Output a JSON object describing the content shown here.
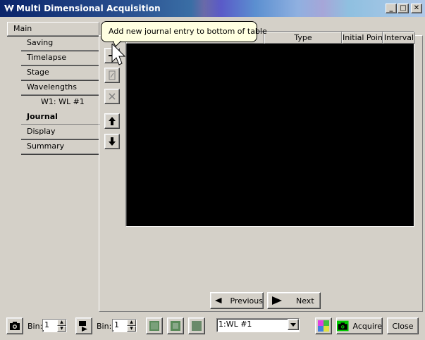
{
  "window": {
    "title": "Multi Dimensional Acquisition",
    "minimize_label": "_",
    "maximize_label": "□",
    "close_label": "✕"
  },
  "nav": {
    "main_label": "Main",
    "items": [
      {
        "label": "Saving"
      },
      {
        "label": "Timelapse"
      },
      {
        "label": "Stage"
      },
      {
        "label": "Wavelengths"
      },
      {
        "label": "W1: WL #1"
      },
      {
        "label": "Journal",
        "selected": true
      },
      {
        "label": "Display"
      },
      {
        "label": "Summary"
      }
    ]
  },
  "tooltip": {
    "text": "Add new journal entry to bottom of table"
  },
  "table": {
    "columns": [
      "",
      "Type",
      "Initial Point",
      "Interval"
    ],
    "rows": []
  },
  "pager": {
    "previous_label": "Previous",
    "next_label": "Next"
  },
  "footer": {
    "bin_label_1": "Bin:",
    "bin_value_1": "1",
    "bin_label_2": "Bin:",
    "bin_value_2": "1",
    "wavelength_select": "1:WL #1",
    "acquire_label": "Acquire",
    "close_label": "Close"
  },
  "colors": {
    "title_bar": "#0a246a",
    "panel_bg": "#d4d0c8",
    "table_bg": "#000000",
    "tooltip_bg": "#ffffe1",
    "camera_green": "#00c800"
  }
}
